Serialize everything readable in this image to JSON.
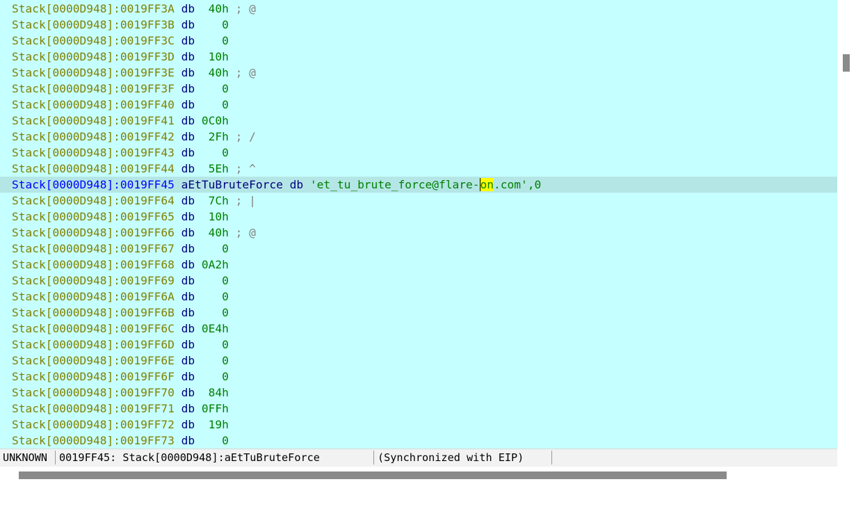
{
  "listing": {
    "lines": [
      {
        "addr": "Stack[0000D948]:0019FF3A",
        "mnem": "db",
        "val": " 40h",
        "comment": " ; @"
      },
      {
        "addr": "Stack[0000D948]:0019FF3B",
        "mnem": "db",
        "val": "   0",
        "comment": ""
      },
      {
        "addr": "Stack[0000D948]:0019FF3C",
        "mnem": "db",
        "val": "   0",
        "comment": ""
      },
      {
        "addr": "Stack[0000D948]:0019FF3D",
        "mnem": "db",
        "val": " 10h",
        "comment": ""
      },
      {
        "addr": "Stack[0000D948]:0019FF3E",
        "mnem": "db",
        "val": " 40h",
        "comment": " ; @"
      },
      {
        "addr": "Stack[0000D948]:0019FF3F",
        "mnem": "db",
        "val": "   0",
        "comment": ""
      },
      {
        "addr": "Stack[0000D948]:0019FF40",
        "mnem": "db",
        "val": "   0",
        "comment": ""
      },
      {
        "addr": "Stack[0000D948]:0019FF41",
        "mnem": "db",
        "val": "0C0h",
        "comment": ""
      },
      {
        "addr": "Stack[0000D948]:0019FF42",
        "mnem": "db",
        "val": " 2Fh",
        "comment": " ; /"
      },
      {
        "addr": "Stack[0000D948]:0019FF43",
        "mnem": "db",
        "val": "   0",
        "comment": ""
      },
      {
        "addr": "Stack[0000D948]:0019FF44",
        "mnem": "db",
        "val": " 5Eh",
        "comment": " ; ^"
      }
    ],
    "current": {
      "addr": "Stack[0000D948]:0019FF45",
      "label": "aEtTuBruteForce",
      "mnem": "db",
      "str_open": "'et_tu_brute_force@flare-",
      "str_cursor1": "o",
      "str_cursor2": "n",
      "str_close": ".com'",
      "tail": ",0"
    },
    "lines_after": [
      {
        "addr": "Stack[0000D948]:0019FF64",
        "mnem": "db",
        "val": " 7Ch",
        "comment": " ; |"
      },
      {
        "addr": "Stack[0000D948]:0019FF65",
        "mnem": "db",
        "val": " 10h",
        "comment": ""
      },
      {
        "addr": "Stack[0000D948]:0019FF66",
        "mnem": "db",
        "val": " 40h",
        "comment": " ; @"
      },
      {
        "addr": "Stack[0000D948]:0019FF67",
        "mnem": "db",
        "val": "   0",
        "comment": ""
      },
      {
        "addr": "Stack[0000D948]:0019FF68",
        "mnem": "db",
        "val": "0A2h",
        "comment": ""
      },
      {
        "addr": "Stack[0000D948]:0019FF69",
        "mnem": "db",
        "val": "   0",
        "comment": ""
      },
      {
        "addr": "Stack[0000D948]:0019FF6A",
        "mnem": "db",
        "val": "   0",
        "comment": ""
      },
      {
        "addr": "Stack[0000D948]:0019FF6B",
        "mnem": "db",
        "val": "   0",
        "comment": ""
      },
      {
        "addr": "Stack[0000D948]:0019FF6C",
        "mnem": "db",
        "val": "0E4h",
        "comment": ""
      },
      {
        "addr": "Stack[0000D948]:0019FF6D",
        "mnem": "db",
        "val": "   0",
        "comment": ""
      },
      {
        "addr": "Stack[0000D948]:0019FF6E",
        "mnem": "db",
        "val": "   0",
        "comment": ""
      },
      {
        "addr": "Stack[0000D948]:0019FF6F",
        "mnem": "db",
        "val": "   0",
        "comment": ""
      },
      {
        "addr": "Stack[0000D948]:0019FF70",
        "mnem": "db",
        "val": " 84h",
        "comment": ""
      },
      {
        "addr": "Stack[0000D948]:0019FF71",
        "mnem": "db",
        "val": "0FFh",
        "comment": ""
      },
      {
        "addr": "Stack[0000D948]:0019FF72",
        "mnem": "db",
        "val": " 19h",
        "comment": ""
      },
      {
        "addr": "Stack[0000D948]:0019FF73",
        "mnem": "db",
        "val": "   0",
        "comment": ""
      }
    ]
  },
  "status": {
    "segment_type": "UNKNOWN",
    "location": "0019FF45: Stack[0000D948]:aEtTuBruteForce",
    "sync": "(Synchronized with EIP)"
  },
  "colors": {
    "background": "#c6ffff",
    "current_line": "#b4e6e6",
    "address": "#808000",
    "mnemonic": "#000080",
    "value": "#008000",
    "highlight": "#ffff00"
  }
}
